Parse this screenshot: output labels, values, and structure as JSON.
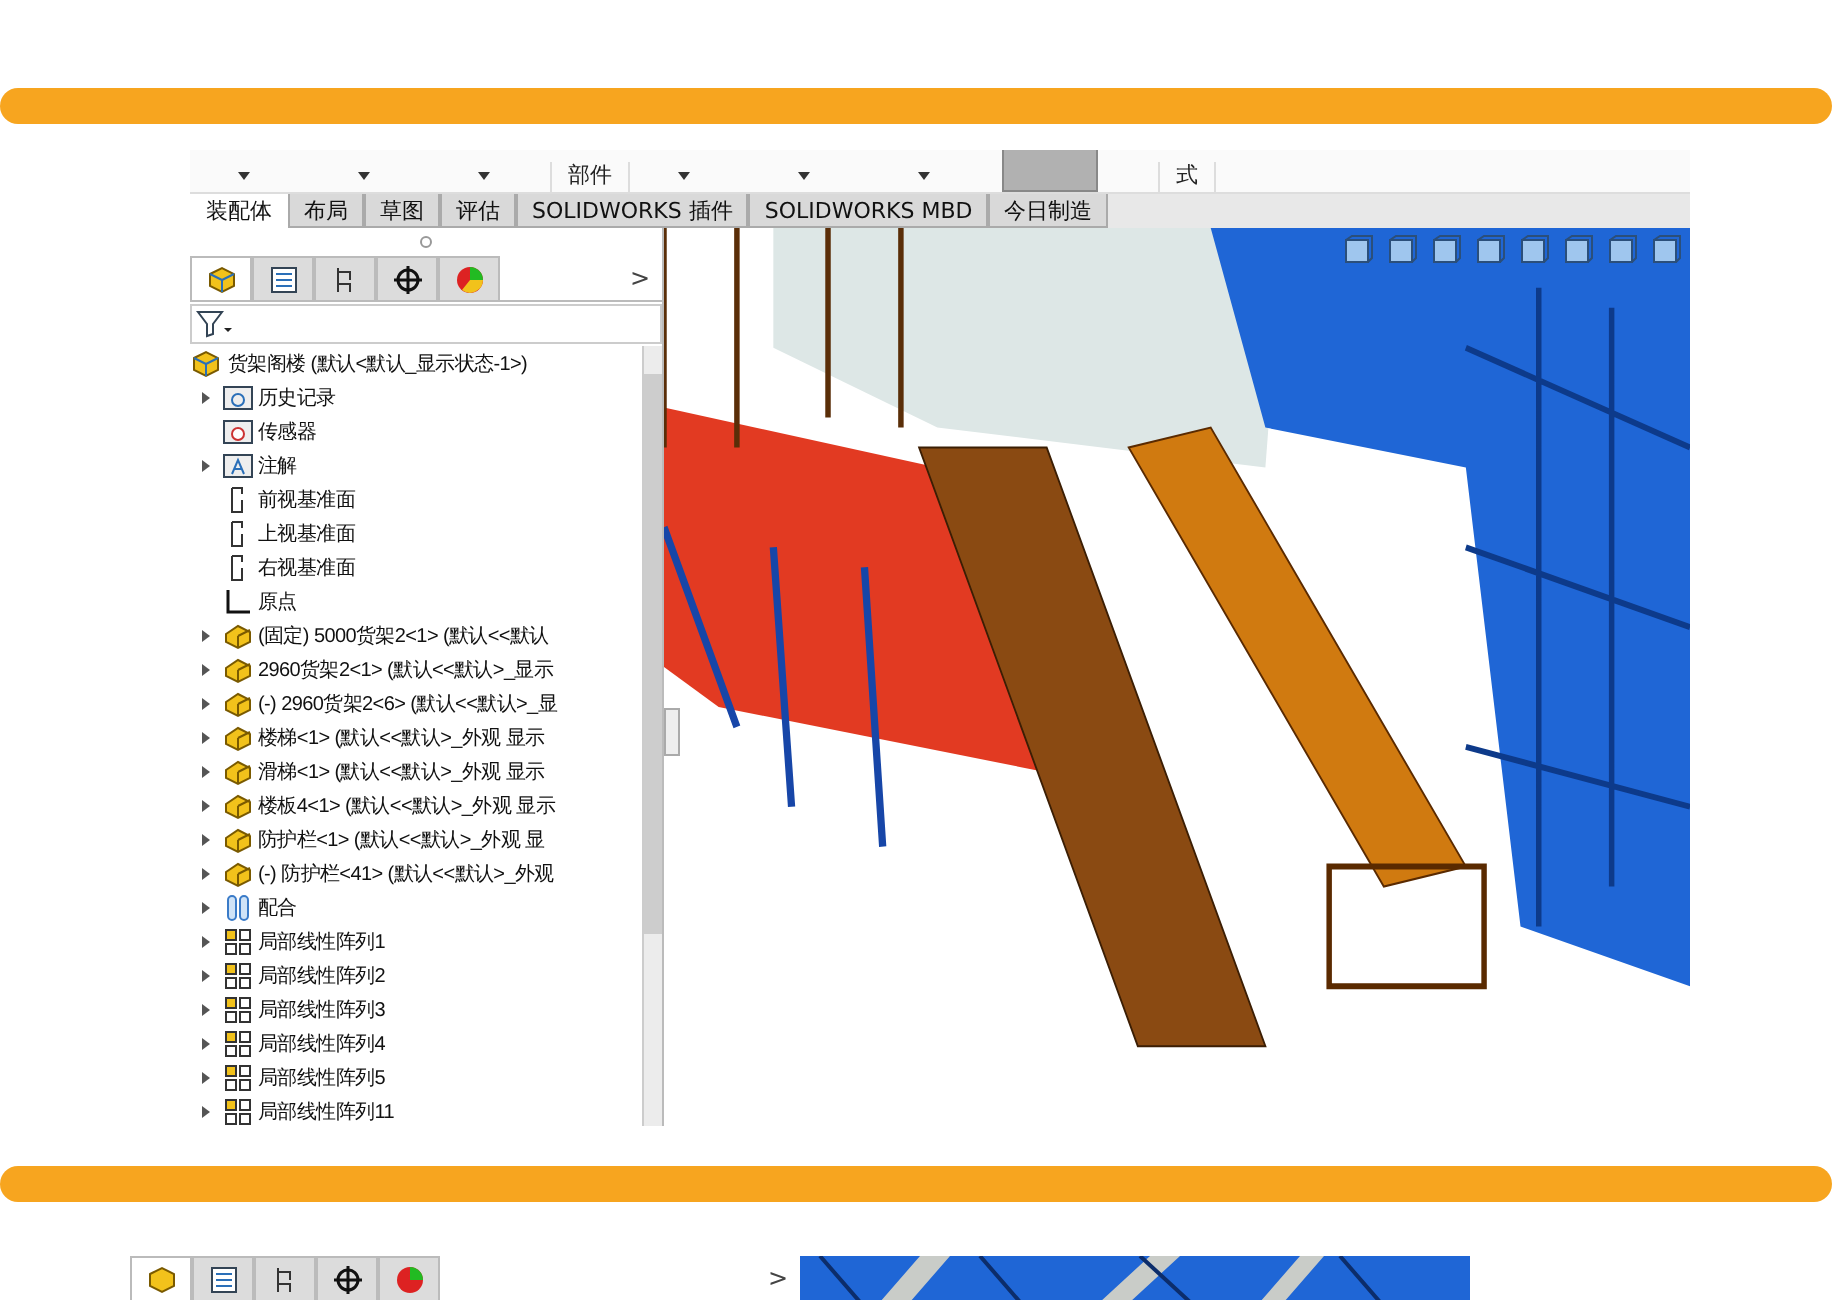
{
  "screenshot": {
    "toolbar": [
      {
        "kind": "caret"
      },
      {
        "kind": "caret"
      },
      {
        "kind": "caret"
      },
      {
        "kind": "label",
        "label": "部件"
      },
      {
        "kind": "caret"
      },
      {
        "kind": "caret"
      },
      {
        "kind": "caret"
      },
      {
        "kind": "swatch"
      },
      {
        "kind": "label",
        "label": "式"
      }
    ],
    "tabs": [
      {
        "label": "装配体",
        "selected": true
      },
      {
        "label": "布局",
        "selected": false
      },
      {
        "label": "草图",
        "selected": false
      },
      {
        "label": "评估",
        "selected": false
      },
      {
        "label": "SOLIDWORKS 插件",
        "selected": false
      },
      {
        "label": "SOLIDWORKS MBD",
        "selected": false
      },
      {
        "label": "今日制造",
        "selected": false
      }
    ],
    "panel_tabs": [
      {
        "kind": "feature",
        "selected": true
      },
      {
        "kind": "property",
        "selected": false
      },
      {
        "kind": "config",
        "selected": false
      },
      {
        "kind": "dim",
        "selected": false
      },
      {
        "kind": "display",
        "selected": false
      }
    ],
    "more_glyph": ">",
    "tree": {
      "label": "货架阁楼 (默认<默认_显示状态-1>)",
      "kind": "assembly",
      "children": [
        {
          "label": "历史记录",
          "kind": "history",
          "has_children": true
        },
        {
          "label": "传感器",
          "kind": "sensor",
          "has_children": false
        },
        {
          "label": "注解",
          "kind": "annotation",
          "has_children": true
        },
        {
          "label": "前视基准面",
          "kind": "plane",
          "has_children": false
        },
        {
          "label": "上视基准面",
          "kind": "plane",
          "has_children": false
        },
        {
          "label": "右视基准面",
          "kind": "plane",
          "has_children": false
        },
        {
          "label": "原点",
          "kind": "origin",
          "has_children": false
        },
        {
          "label": "(固定) 5000货架2<1> (默认<<默认",
          "kind": "part",
          "has_children": true
        },
        {
          "label": "2960货架2<1> (默认<<默认>_显示",
          "kind": "part",
          "has_children": true
        },
        {
          "label": "(-) 2960货架2<6> (默认<<默认>_显",
          "kind": "part",
          "has_children": true
        },
        {
          "label": "楼梯<1> (默认<<默认>_外观 显示",
          "kind": "part",
          "has_children": true
        },
        {
          "label": "滑梯<1> (默认<<默认>_外观 显示",
          "kind": "part",
          "has_children": true
        },
        {
          "label": "楼板4<1> (默认<<默认>_外观 显示",
          "kind": "part",
          "has_children": true
        },
        {
          "label": "防护栏<1> (默认<<默认>_外观 显",
          "kind": "part",
          "has_children": true
        },
        {
          "label": "(-) 防护栏<41> (默认<<默认>_外观",
          "kind": "part",
          "has_children": true
        },
        {
          "label": "配合",
          "kind": "mate",
          "has_children": true
        },
        {
          "label": "局部线性阵列1",
          "kind": "pattern",
          "has_children": true
        },
        {
          "label": "局部线性阵列2",
          "kind": "pattern",
          "has_children": true
        },
        {
          "label": "局部线性阵列3",
          "kind": "pattern",
          "has_children": true
        },
        {
          "label": "局部线性阵列4",
          "kind": "pattern",
          "has_children": true
        },
        {
          "label": "局部线性阵列5",
          "kind": "pattern",
          "has_children": true
        },
        {
          "label": "局部线性阵列11",
          "kind": "pattern",
          "has_children": true
        }
      ]
    }
  },
  "second_screenshot": {
    "panel_tabs": [
      {
        "kind": "feature",
        "selected": true
      },
      {
        "kind": "property",
        "selected": false
      },
      {
        "kind": "config",
        "selected": false
      },
      {
        "kind": "dim",
        "selected": false
      },
      {
        "kind": "display",
        "selected": false
      }
    ],
    "more_glyph": ">"
  }
}
